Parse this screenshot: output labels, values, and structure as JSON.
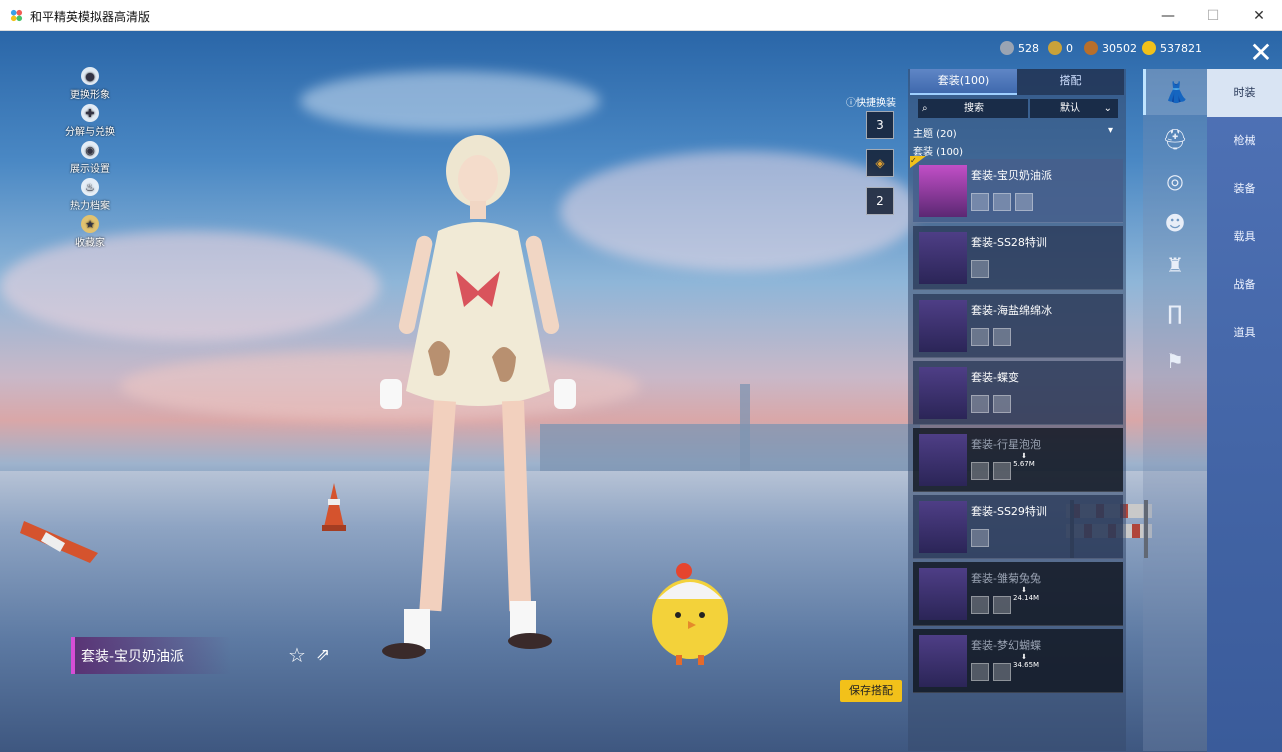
{
  "window": {
    "title": "和平精英模拟器高清版",
    "min": "—",
    "max": "☐",
    "close": "✕"
  },
  "currency": [
    {
      "icon": "silver-coin-icon",
      "value": "528",
      "color": "#9aa4b3"
    },
    {
      "icon": "gold-badge-icon",
      "value": "0",
      "color": "#c9a23a"
    },
    {
      "icon": "bronze-coin-icon",
      "value": "30502",
      "color": "#b86f2b"
    },
    {
      "icon": "gold-coin-icon",
      "value": "537821",
      "color": "#f2c11a"
    }
  ],
  "left_menu": [
    {
      "label": "更换形象",
      "icon": "avatar-icon"
    },
    {
      "label": "分解与兑换",
      "icon": "puzzle-icon"
    },
    {
      "label": "展示设置",
      "icon": "eye-icon"
    },
    {
      "label": "热力档案",
      "icon": "flame-icon"
    },
    {
      "label": "收藏家",
      "icon": "collector-badge-icon"
    }
  ],
  "outfit_label": "套装-宝贝奶油派",
  "quick_change": {
    "title": "快捷换装",
    "slots": [
      "3",
      "",
      "2"
    ]
  },
  "save_button": "保存搭配",
  "panel": {
    "tabs": [
      "套装(100)",
      "搭配"
    ],
    "search_placeholder": "搜索",
    "sort": "默认",
    "category_theme": "主题 (20)",
    "category_suits": "套装 (100)",
    "items": [
      {
        "name": "套装-宝贝奶油派",
        "selected": true,
        "download": ""
      },
      {
        "name": "套装-SS28特训",
        "selected": false,
        "download": ""
      },
      {
        "name": "套装-海盐绵绵冰",
        "selected": false,
        "download": ""
      },
      {
        "name": "套装-蝶变",
        "selected": false,
        "download": ""
      },
      {
        "name": "套装-行星泡泡",
        "selected": false,
        "download": "5.67M"
      },
      {
        "name": "套装-SS29特训",
        "selected": false,
        "download": ""
      },
      {
        "name": "套装-雏菊兔兔",
        "selected": false,
        "download": "24.14M"
      },
      {
        "name": "套装-梦幻蝴蝶",
        "selected": false,
        "download": "34.65M"
      }
    ]
  },
  "category_icons": [
    "outfit-icon",
    "helmet-icon",
    "glasses-icon",
    "mask-icon",
    "top-icon",
    "pants-icon",
    "shoes-icon"
  ],
  "main_tabs": [
    "时装",
    "枪械",
    "装备",
    "载具",
    "战备",
    "道具"
  ]
}
